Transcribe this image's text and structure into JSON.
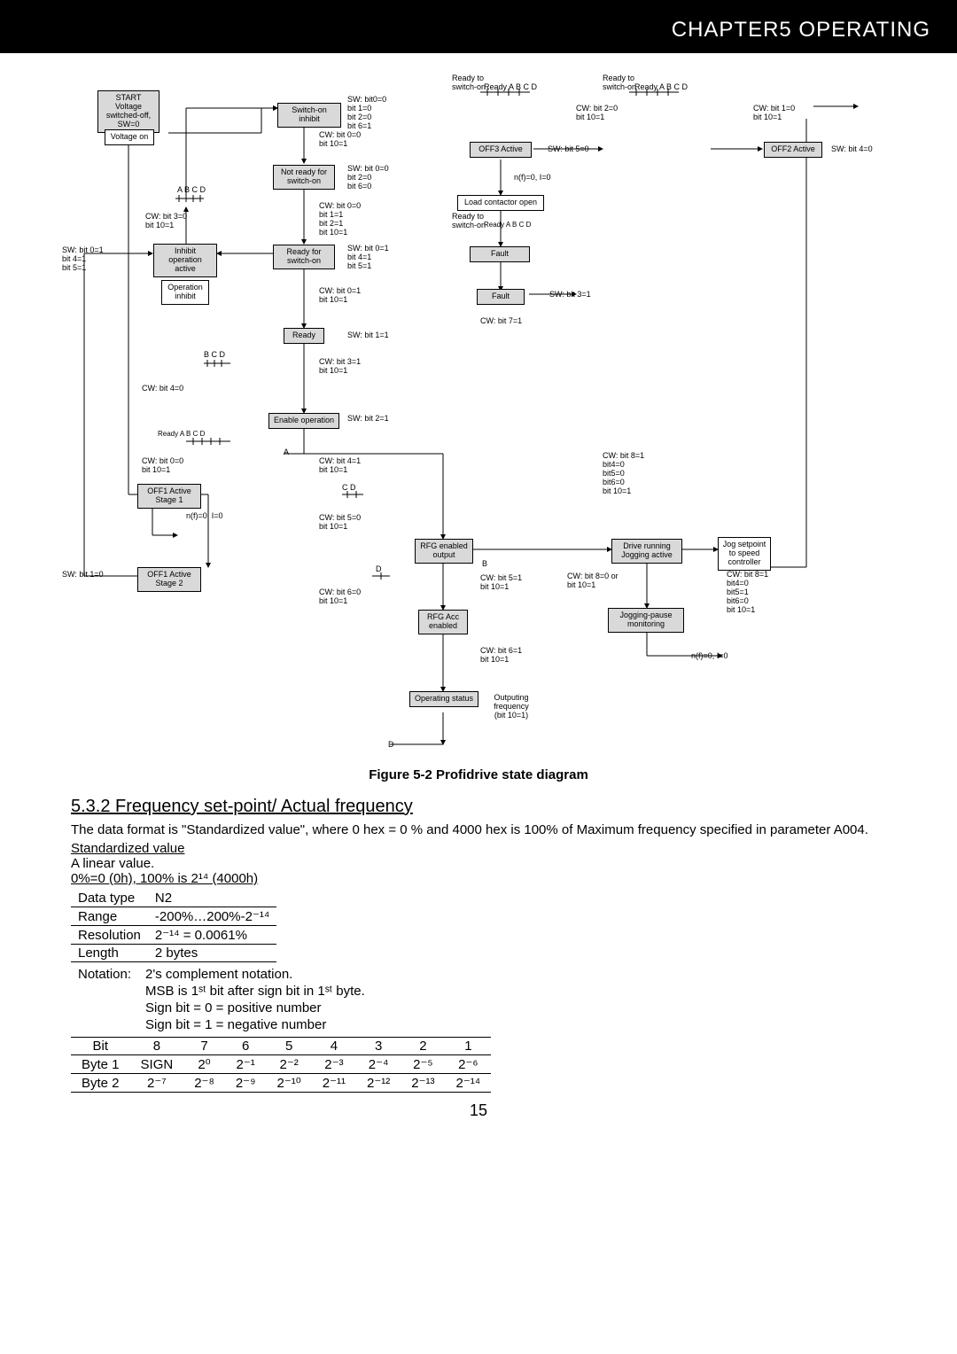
{
  "header": "CHAPTER5   OPERATING",
  "figure_caption": "Figure 5-2 Profidrive state diagram",
  "section_number": "5.3.2",
  "section_title": "Frequency set-point/ Actual frequency",
  "paragraph": "The data format is \"Standardized value\", where 0 hex = 0 % and 4000 hex is 100% of Maximum frequency specified in parameter A004.",
  "std_heading": "Standardized value",
  "linear": "A linear value.",
  "scale_line": "0%=0 (0h), 100% is 2¹⁴ (4000h)",
  "spec": {
    "data_type_label": "Data type",
    "data_type": "N2",
    "range_label": "Range",
    "range": "-200%…200%-2⁻¹⁴",
    "resolution_label": "Resolution",
    "resolution": "2⁻¹⁴ = 0.0061%",
    "length_label": "Length",
    "length": "2 bytes",
    "notation_label": "Notation:",
    "not1": "2's complement notation.",
    "not2": "MSB is 1ˢᵗ bit after sign bit in 1ˢᵗ byte.",
    "not3": "Sign bit = 0 = positive number",
    "not4": "Sign bit = 1 = negative number"
  },
  "bits_header": [
    "Bit",
    "8",
    "7",
    "6",
    "5",
    "4",
    "3",
    "2",
    "1"
  ],
  "byte1": [
    "Byte 1",
    "SIGN",
    "2⁰",
    "2⁻¹",
    "2⁻²",
    "2⁻³",
    "2⁻⁴",
    "2⁻⁵",
    "2⁻⁶"
  ],
  "byte2": [
    "Byte 2",
    "2⁻⁷",
    "2⁻⁸",
    "2⁻⁹",
    "2⁻¹⁰",
    "2⁻¹¹",
    "2⁻¹²",
    "2⁻¹³",
    "2⁻¹⁴"
  ],
  "page": "15",
  "diagram": {
    "start": "START\nVoltage\nswitched-off,\nSW=0",
    "voltage_on": "Voltage on",
    "switch_on_inhibit": "Switch-on inhibit",
    "not_ready": "Not ready for\nswitch-on",
    "inhibit_active": "Inhibit operation\nactive",
    "ready_for_switch_on": "Ready for\nswitch-on",
    "op_inhibit": "Operation\ninhibit",
    "ready": "Ready",
    "enable_op": "Enable operation",
    "off1_s1": "OFF1 Active\nStage 1",
    "off1_s2": "OFF1 Active\nStage 2",
    "rfg_out": "RFG enabled\noutput",
    "rfg_acc": "RFG Acc\nenabled",
    "op_status": "Operating status",
    "off3": "OFF3 Active",
    "load_contactor": "Load contactor open",
    "fault_big": "Fault",
    "fault": "Fault",
    "drive_running": "Drive running\nJogging active",
    "jog_pause": "Jogging-pause\nmonitoring",
    "jog_setpoint": "Jog setpoint\nto speed\ncontroller",
    "off2": "OFF2 Active",
    "outputting": "Outputing\nfrequency\n(bit 10=1)",
    "l_sw_bits1": "SW: bit0=0\nbit 1=0\nbit 2=0\nbit 6=1",
    "l_cw00_101": "CW: bit 0=0\nbit 10=1",
    "l_sw00_20_60": "SW: bit 0=0\nbit 2=0\nbit 6=0",
    "l_cw00_b11_b21_101": "CW: bit 0=0\nbit 1=1\nbit 2=1\nbit 10=1",
    "l_sw01_41_51": "SW: bit 0=1\nbit 4=1\nbit 5=1",
    "l_cw01_101": "CW: bit 0=1\nbit 10=1",
    "l_sw11": "SW: bit 1=1",
    "l_cw31_101": "CW: bit 3=1\nbit 10=1",
    "l_sw21": "SW: bit 2=1",
    "l_cw41_101": "CW: bit 4=1\nbit 10=1",
    "l_cw50_101": "CW: bit 5=0\nbit 10=1",
    "l_cw51_101": "CW: bit 5=1\nbit 10=1",
    "l_cw60_101": "CW: bit 6=0\nbit 10=1",
    "l_cw61_101": "CW: bit 6=1\nbit 10=1",
    "l_ready_switch_on": "Ready to\nswitch-on",
    "l_ready_abc": "Ready   A   B   C   D",
    "l_cw20_101": "CW: bit 2=0\nbit 10=1",
    "l_sw_b50": "SW: bit 5=0",
    "l_nf0": "n(f)=0, I=0",
    "l_sw_b31": "SW: bit 3=1",
    "l_cw71": "CW: bit 7=1",
    "l_cw10_101": "CW: bit 1=0\nbit 10=1",
    "l_sw_b40": "SW: bit 4=0",
    "l_cw81_440_50_60_101": "CW: bit 8=1\nbit4=0\nbit5=0\nbit6=0\nbit 10=1",
    "l_cw80_101": "CW: bit 8=0 or\nbit 10=1",
    "l_cw81_440_51_61_101": "CW: bit 8=1\nbit4=0\nbit5=1\nbit6=0\nbit 10=1",
    "l_cw30_101": "CW: bit 3=0\nbit 10=1",
    "l_cw40": "CW: bit 4=0",
    "l_sw_b10": "SW: bit 1=0",
    "l_sw01_4151": "SW: bit 0=1\nbit 4=1\nbit 5=1",
    "l_cw00_101b": "CW: bit 0=0\nbit 10=1",
    "l_abcd": "A   B   C   D",
    "l_bcd": "B   C   D",
    "l_cd": "C   D",
    "l_d": "D",
    "l_a": "A",
    "l_b": "B"
  }
}
